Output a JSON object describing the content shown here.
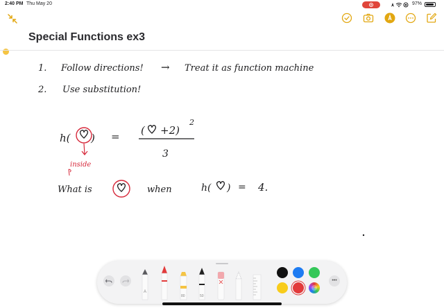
{
  "status_bar": {
    "time": "2:40 PM",
    "date": "Thu May 20",
    "battery": "97%",
    "icons": [
      "screen-record-icon",
      "location-icon",
      "wifi-icon",
      "orientation-lock-icon",
      "battery-icon"
    ]
  },
  "toolbar": {
    "icons": [
      "collapse-icon",
      "checklist-icon",
      "camera-icon",
      "markup-pen-icon",
      "more-icon",
      "compose-icon"
    ],
    "accent": "#e2a711"
  },
  "note": {
    "title": "Special Functions ex3",
    "handwriting": {
      "line1_number": "1.",
      "line1_text": "Follow directions!",
      "line1_arrow": "→",
      "line1_rest": "Treat it as function machine",
      "line2_number": "2.",
      "line2_text": "Use substitution!",
      "lhs": "h(",
      "lhs_close": ")",
      "equals": "=",
      "numerator_open": "(",
      "numerator_rest": "+2)",
      "exponent": "2",
      "denominator": "3",
      "annotation": "inside",
      "question_start": "What is",
      "question_when": "when",
      "question_fn": "h(",
      "question_close": ")",
      "question_equals": "=",
      "question_value": "4."
    },
    "ink_colors": {
      "black": "#1c1c1e",
      "red": "#d6283a"
    }
  },
  "pen_tray": {
    "tools": [
      "undo-icon",
      "redo-icon",
      "pen-tool",
      "monoline-tool",
      "highlighter-tool",
      "fountain-pen-tool",
      "eraser-tool",
      "lasso-tool",
      "ruler-tool"
    ],
    "colors": [
      "#111111",
      "#1e7cf2",
      "#34c759",
      "#f8cc1b",
      "#e23b3b"
    ],
    "selected_color": "#e23b3b",
    "more_label": "•••"
  }
}
